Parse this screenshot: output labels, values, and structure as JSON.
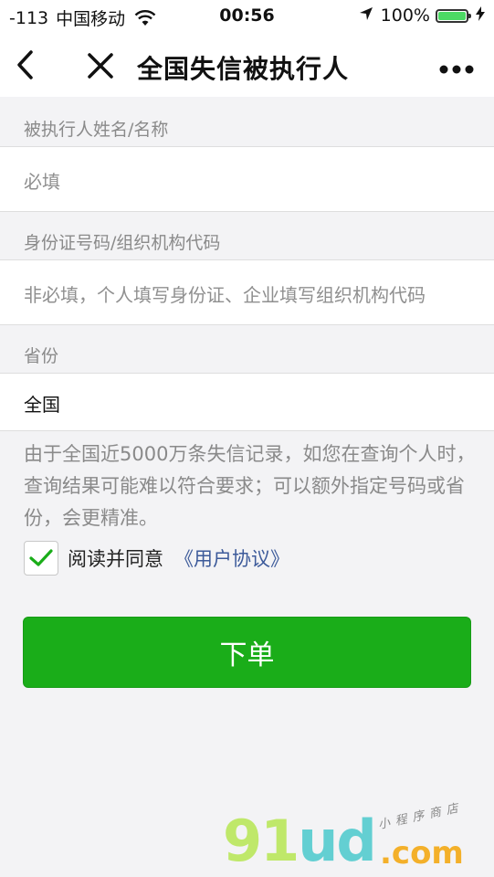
{
  "status_bar": {
    "signal": "-113",
    "carrier": "中国移动",
    "time": "00:56",
    "battery_pct": "100%",
    "battery_level": 1.0
  },
  "nav": {
    "title": "全国失信被执行人",
    "back_icon": "chevron-left-icon",
    "close_icon": "close-icon",
    "more_icon": "more-icon"
  },
  "form": {
    "name_label": "被执行人姓名/名称",
    "name_placeholder": "必填",
    "id_label": "身份证号码/组织机构代码",
    "id_placeholder": "非必填，个人填写身份证、企业填写组织机构代码",
    "province_label": "省份",
    "province_value": "全国"
  },
  "notice": "由于全国近5000万条失信记录，如您在查询个人时，查询结果可能难以符合要求；可以额外指定号码或省份，会更精准。",
  "agreement": {
    "checked": true,
    "text": "阅读并同意",
    "link": "《用户协议》"
  },
  "submit_label": "下单",
  "watermark": {
    "part1": "91",
    "part2": "ud",
    "suffix": ".com",
    "tagline": "小程序商店"
  },
  "colors": {
    "primary": "#1aad19",
    "link": "#3c5a9a",
    "battery": "#4cd964",
    "background": "#f3f3f5"
  }
}
